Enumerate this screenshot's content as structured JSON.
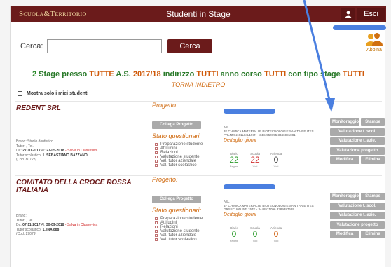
{
  "header": {
    "logo": "Scuola&Territorio",
    "title": "Studenti in Stage",
    "logout_label": "Esci"
  },
  "search": {
    "label": "Cerca:",
    "value": "",
    "button_label": "Cerca"
  },
  "abbina": {
    "label": "Abbina"
  },
  "heading": {
    "count": "2",
    "p1": " Stage presso ",
    "tutte": "TUTTE",
    "p2": " A.S. ",
    "year": "2017/18",
    "p3": " indirizzo ",
    "tutti1": "TUTTI",
    "p4": " anno corso ",
    "tutti2": "TUTTI",
    "p5": " con tipo stage ",
    "tutti3": "TUTTI"
  },
  "torna_label": "TORNA INDIETRO",
  "show_mine_label": "Mostra solo i miei studenti",
  "entries": [
    {
      "company": "REDENT SRL",
      "brand": "Brand: Studio dentistico",
      "tutor": "Tutor: , Tel.:",
      "dates_prefix": "Da: ",
      "date_from": "27-10-2017",
      "dates_mid": " Al: ",
      "date_to": "27-05-2018",
      "salva": " - Salva in Classeviva",
      "tutor_scol_prefix": "Tutor scolastico: ",
      "student": "1. SEBASTIANO BAZZANO",
      "code": "(Cod. 80728)",
      "progetto": "Progetto:",
      "collega_label": "Collega Progetto",
      "stato": "Stato questionari:",
      "questionari": [
        "Preparazione studente",
        "Attitudini",
        "Relazioni",
        "Valutazione studente",
        "Val. tutor aziendale",
        "Val. tutor scolastico"
      ],
      "asl": [
        "ASL",
        "3F CHIMICA MATERIALI E BIOTECNOLOGIE SANITARIE ITES",
        "PRLNMN101L84L157N - 3484950795 3346981081"
      ],
      "dettaglio": "Dettaglio giorni",
      "stats": [
        {
          "label": "Diario",
          "value": "22",
          "sub": "Pagine",
          "color": "g"
        },
        {
          "label": "Scuola",
          "value": "22",
          "sub": "Voti",
          "color": "r"
        },
        {
          "label": "Azienda",
          "value": "0",
          "sub": "Voti",
          "color": "k"
        }
      ],
      "actions": [
        [
          "Monitoraggio",
          "Stampe"
        ],
        [
          "Valutazione t. scol."
        ],
        [
          "Valutazione t. azie."
        ],
        [
          "Valutazione progetto"
        ],
        [
          "Modifica",
          "Elimina"
        ]
      ]
    },
    {
      "company": "COMITATO DELLA CROCE ROSSA ITALIANA",
      "brand": "Brand:",
      "tutor": "Tutor: , Tel.:",
      "dates_prefix": "Da: ",
      "date_from": "07-11-2017",
      "dates_mid": " Al: ",
      "date_to": "30-09-2018",
      "salva": " - Salva in Classeviva",
      "tutor_scol_prefix": "Tutor scolastico: ",
      "student": "1. INA 888",
      "code": "(Cod. 29079)",
      "progetto": "Progetto:",
      "collega_label": "Collega Progetto",
      "stato": "Stato questionari:",
      "questionari": [
        "Preparazione studente",
        "Attitudini",
        "Relazioni",
        "Valutazione studente",
        "Val. tutor aziendale",
        "Val. tutor scolastico"
      ],
      "asl": [
        "ASL",
        "4F CHIMICA MATERIALI E BIOTECNOLOGIE SANITARIE ITES",
        "GRSSCU00U57L157K - 3448521096 3389387689"
      ],
      "dettaglio": "Dettaglio giorni",
      "stats": [
        {
          "label": "Diario",
          "value": "0",
          "sub": "Pagine",
          "color": "g"
        },
        {
          "label": "Scuola",
          "value": "0",
          "sub": "Voti",
          "color": "g"
        },
        {
          "label": "Azienda",
          "value": "0",
          "sub": "Voti",
          "color": "o"
        }
      ],
      "actions": [
        [
          "Monitoraggio",
          "Stampe"
        ],
        [
          "Valutazione t. scol."
        ],
        [
          "Valutazione t. azie."
        ],
        [
          "Valutazione progetto"
        ],
        [
          "Modifica",
          "Elimina"
        ]
      ]
    }
  ],
  "colors": {
    "brand": "#6b1b1b",
    "accent_orange": "#d06a10",
    "green": "#2a7a2a",
    "annotation_blue": "#4a7fe0",
    "button_gray": "#aaaaaa"
  }
}
